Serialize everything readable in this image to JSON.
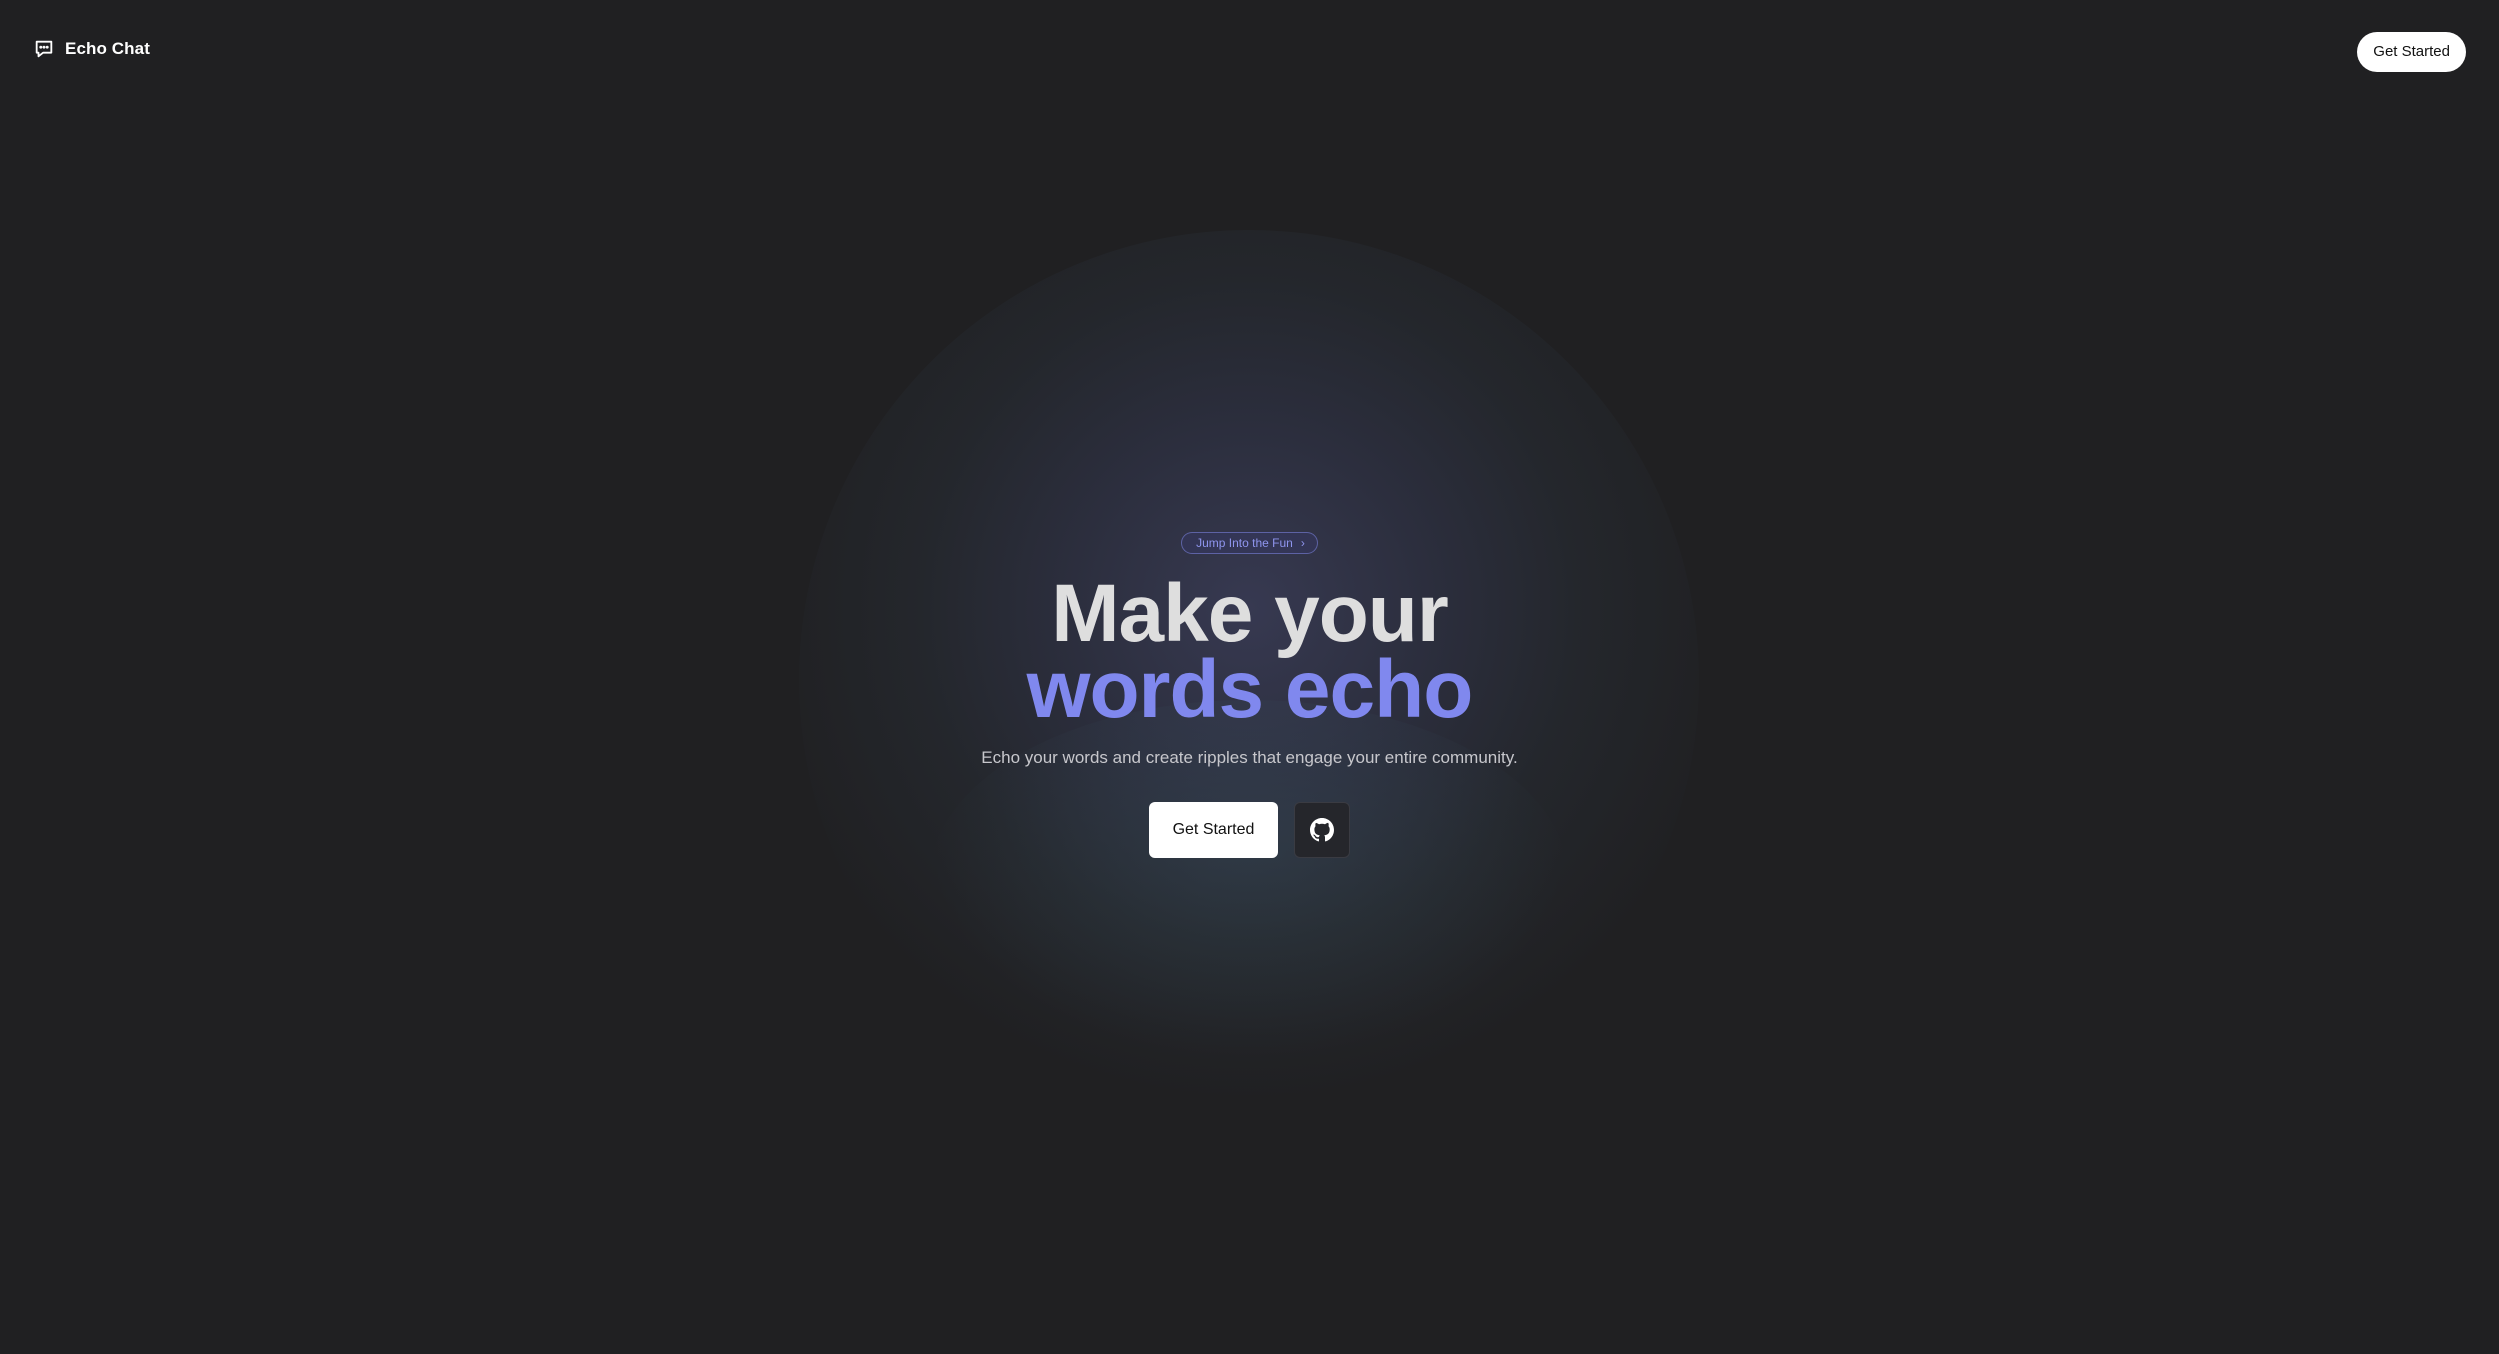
{
  "header": {
    "brand_name": "Echo Chat",
    "brand_icon": "chat-bubble-icon",
    "cta_label": "Get Started"
  },
  "hero": {
    "pill_label": "Jump Into the Fun",
    "pill_icon": "chevron-right-icon",
    "headline_line1": "Make your",
    "headline_line2": "words echo",
    "subtitle": "Echo your words and create ripples that engage your entire community.",
    "primary_button_label": "Get Started",
    "secondary_button_icon": "github-icon"
  },
  "colors": {
    "background": "#202022",
    "accent": "#8088ee",
    "headline": "#dedede",
    "button_bg": "#ffffff"
  }
}
